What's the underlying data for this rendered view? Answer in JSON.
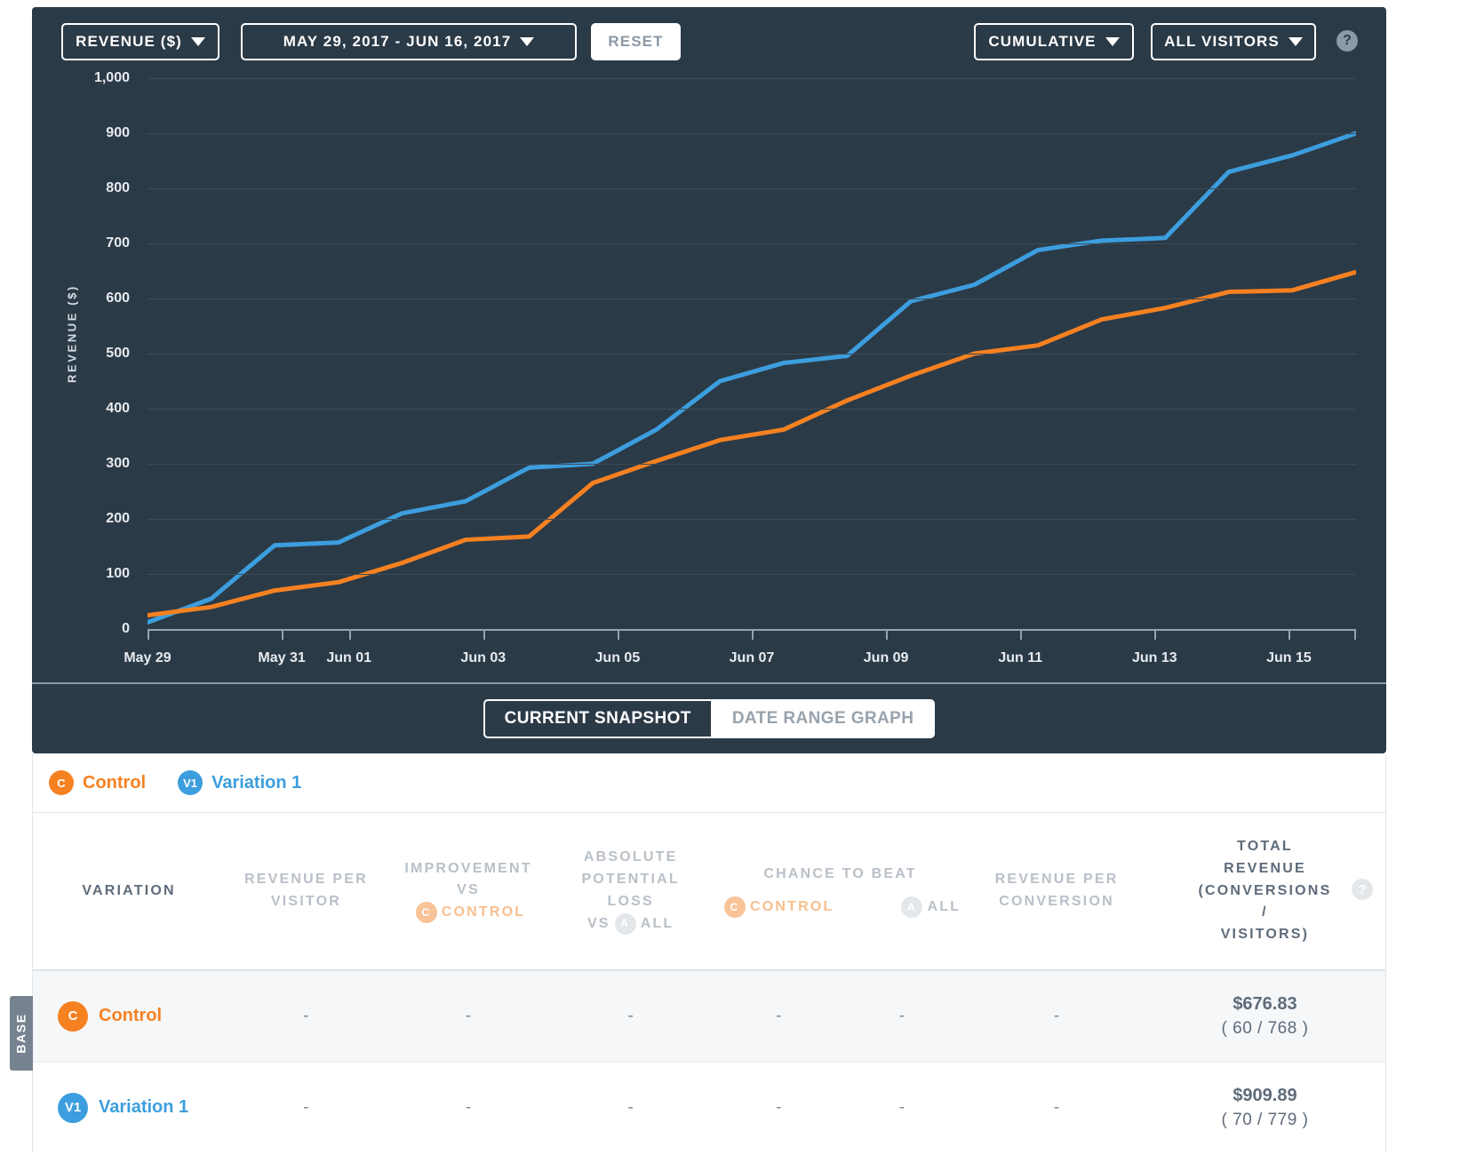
{
  "toolbar": {
    "metric_label": "REVENUE ($)",
    "date_range_label": "MAY 29, 2017 - JUN 16, 2017",
    "reset_label": "RESET",
    "cumulative_label": "CUMULATIVE",
    "visitors_label": "ALL VISITORS",
    "help_label": "?"
  },
  "tabs": {
    "current_snapshot": "CURRENT SNAPSHOT",
    "date_range_graph": "DATE RANGE GRAPH"
  },
  "legend": {
    "items": [
      {
        "badge": "C",
        "label": "Control",
        "color": "#f68121"
      },
      {
        "badge": "V1",
        "label": "Variation 1",
        "color": "#3c9ede"
      }
    ]
  },
  "table": {
    "help_label": "?",
    "base_tag": "BASE",
    "headers": {
      "variation": "VARIATION",
      "revenue_per_visitor_l1": "REVENUE PER",
      "revenue_per_visitor_l2": "VISITOR",
      "improvement_l1": "IMPROVEMENT",
      "improvement_l2": "VS",
      "improvement_badge": "C",
      "improvement_l3": "CONTROL",
      "apl_l1": "ABSOLUTE",
      "apl_l2": "POTENTIAL",
      "apl_l3": "LOSS",
      "apl_l4_pre": "VS",
      "apl_badge": "A",
      "apl_l4_post": "ALL",
      "ctb_l1": "CHANCE TO BEAT",
      "ctb_badge_c": "C",
      "ctb_control": "CONTROL",
      "ctb_badge_a": "A",
      "ctb_all": "ALL",
      "rpc_l1": "REVENUE PER",
      "rpc_l2": "CONVERSION",
      "total_l1": "TOTAL",
      "total_l2": "REVENUE",
      "total_l3": "(CONVERSIONS",
      "total_l4": "/",
      "total_l5": "VISITORS)"
    },
    "rows": [
      {
        "badge": "C",
        "name": "Control",
        "revenue_per_visitor": "-",
        "improvement": "-",
        "absolute_potential_loss": "-",
        "chance_to_beat_control": "-",
        "chance_to_beat_all": "-",
        "revenue_per_conversion": "-",
        "total_revenue": "$676.83",
        "conversions_visitors": "( 60 / 768 )"
      },
      {
        "badge": "V1",
        "name": "Variation 1",
        "revenue_per_visitor": "-",
        "improvement": "-",
        "absolute_potential_loss": "-",
        "chance_to_beat_control": "-",
        "chance_to_beat_all": "-",
        "revenue_per_conversion": "-",
        "total_revenue": "$909.89",
        "conversions_visitors": "( 70 / 779 )"
      }
    ]
  },
  "chart_data": {
    "type": "line",
    "title": "",
    "xlabel": "",
    "ylabel": "REVENUE ($)",
    "ylim": [
      0,
      1000
    ],
    "yticks": [
      0,
      100,
      200,
      300,
      400,
      500,
      600,
      700,
      800,
      900,
      1000
    ],
    "ytick_labels": [
      "0",
      "100",
      "200",
      "300",
      "400",
      "500",
      "600",
      "700",
      "800",
      "900",
      "1,000"
    ],
    "grid": true,
    "legend_position": "below-chart",
    "x": [
      "May 29",
      "May 30",
      "May 31",
      "Jun 01",
      "Jun 02",
      "Jun 03",
      "Jun 04",
      "Jun 05",
      "Jun 06",
      "Jun 07",
      "Jun 08",
      "Jun 09",
      "Jun 10",
      "Jun 11",
      "Jun 12",
      "Jun 13",
      "Jun 14",
      "Jun 15",
      "Jun 16"
    ],
    "xtick_labels": [
      "May 29",
      "May 31",
      "Jun 01",
      "Jun 03",
      "Jun 05",
      "Jun 07",
      "Jun 09",
      "Jun 11",
      "Jun 13",
      "Jun 15"
    ],
    "series": [
      {
        "name": "Variation 1",
        "color": "#3c9ede",
        "values": [
          12,
          55,
          152,
          157,
          210,
          232,
          293,
          300,
          362,
          450,
          483,
          496,
          595,
          625,
          688,
          705,
          710,
          830,
          860,
          900
        ]
      },
      {
        "name": "Control",
        "color": "#f68121",
        "values": [
          25,
          40,
          70,
          85,
          120,
          162,
          168,
          265,
          305,
          343,
          362,
          415,
          460,
          500,
          515,
          562,
          583,
          612,
          615,
          648
        ]
      }
    ]
  }
}
